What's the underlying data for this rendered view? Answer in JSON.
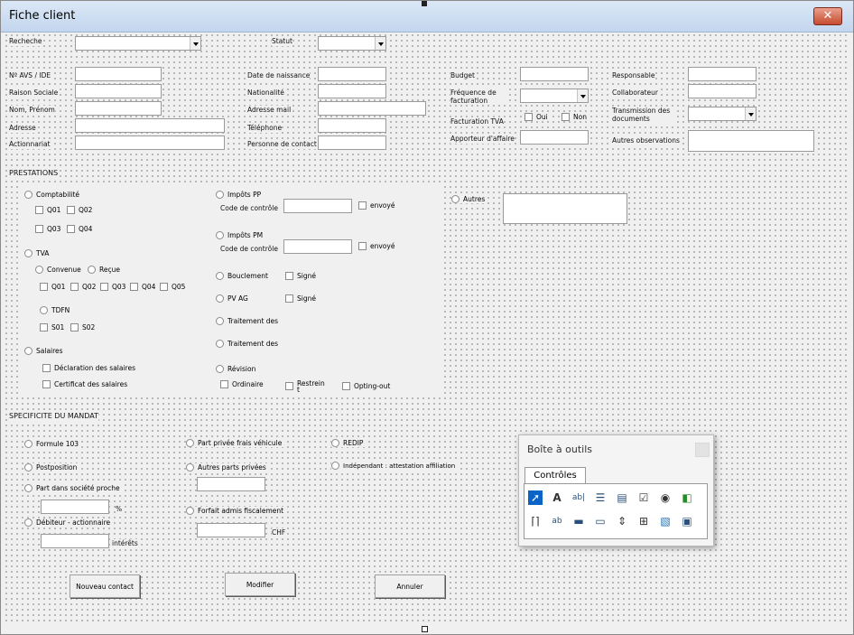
{
  "window": {
    "title": "Fiche client",
    "close_symbol": "✕"
  },
  "top": {
    "recheche_label": "Recheche",
    "recheche_value": "",
    "statut_label": "Statut",
    "statut_value": ""
  },
  "client": {
    "avs_label": "Nº AVS / IDE",
    "raison_label": "Raison Sociale",
    "nom_label": "Nom, Prénom",
    "adresse_label": "Adresse",
    "actionnariat_label": "Actionnariat",
    "naissance_label": "Date de naissance",
    "nationalite_label": "Nationalité",
    "mail_label": "Adresse mail",
    "telephone_label": "Téléphone",
    "contact_label": "Personne de contact",
    "budget_label": "Budget",
    "frequence_label": "Fréquence de facturation",
    "facturation_tva_label": "Facturation TVA",
    "oui_label": "Oui",
    "non_label": "Non",
    "apporteur_label": "Apporteur d'affaire",
    "responsable_label": "Responsable",
    "collaborateur_label": "Collaborateur",
    "transmission_label": "Transmission des documents",
    "observations_label": "Autres observations"
  },
  "prestations": {
    "heading": "PRESTATIONS",
    "comptabilite": "Comptabilité",
    "q01": "Q01",
    "q02": "Q02",
    "q03": "Q03",
    "q04": "Q04",
    "q05": "Q05",
    "tva": "TVA",
    "convenue": "Convenue",
    "recue": "Reçue",
    "tdfn": "TDFN",
    "s01": "S01",
    "s02": "S02",
    "salaires": "Salaires",
    "declaration": "Déclaration des salaires",
    "certificat": "Certificat des salaires",
    "impots_pp": "Impôts PP",
    "impots_pm": "Impôts PM",
    "code_controle": "Code de contrôle",
    "envoye": "envoyé",
    "bouclement": "Bouclement",
    "signe": "Signé",
    "pv_ag": "PV AG",
    "traitement1": "Traitement des",
    "traitement2": "Traitement des",
    "revision": "Révision",
    "ordinaire": "Ordinaire",
    "restrein": "Restrein",
    "restrein_extra": "t",
    "opting_out": "Opting-out",
    "autres": "Autres"
  },
  "mandat": {
    "heading": "SPECIFICITE DU MANDAT",
    "formule": "Formule 103",
    "postposition": "Postposition",
    "part_societe": "Part dans société proche",
    "percent": "%",
    "debiteur": "Débiteur - actionnaire",
    "interets": "intérêts",
    "part_privee": "Part privée frais véhicule",
    "autres_parts": "Autres parts privées",
    "forfait": "Forfait admis fiscalement",
    "chf": "CHF",
    "redip": "REDIP",
    "independant": "Indépendant : attestation affiliation"
  },
  "buttons": {
    "nouveau": "Nouveau contact",
    "modifier": "Modifier",
    "annuler": "Annuler"
  },
  "toolbox": {
    "title": "Boîte à outils",
    "tab": "Contrôles",
    "tools_row1": [
      "select-objects-icon",
      "label-icon",
      "textbox-icon",
      "combobox-icon",
      "listbox-icon",
      "checkbox-icon",
      "optionbutton-icon",
      "togglebutton-icon"
    ],
    "tools_row2": [
      "frame-icon",
      "commandbutton-icon",
      "tabstrip-icon",
      "multipage-icon",
      "scrollbar-icon",
      "spinbutton-icon",
      "image-icon",
      "refedit-icon"
    ]
  }
}
